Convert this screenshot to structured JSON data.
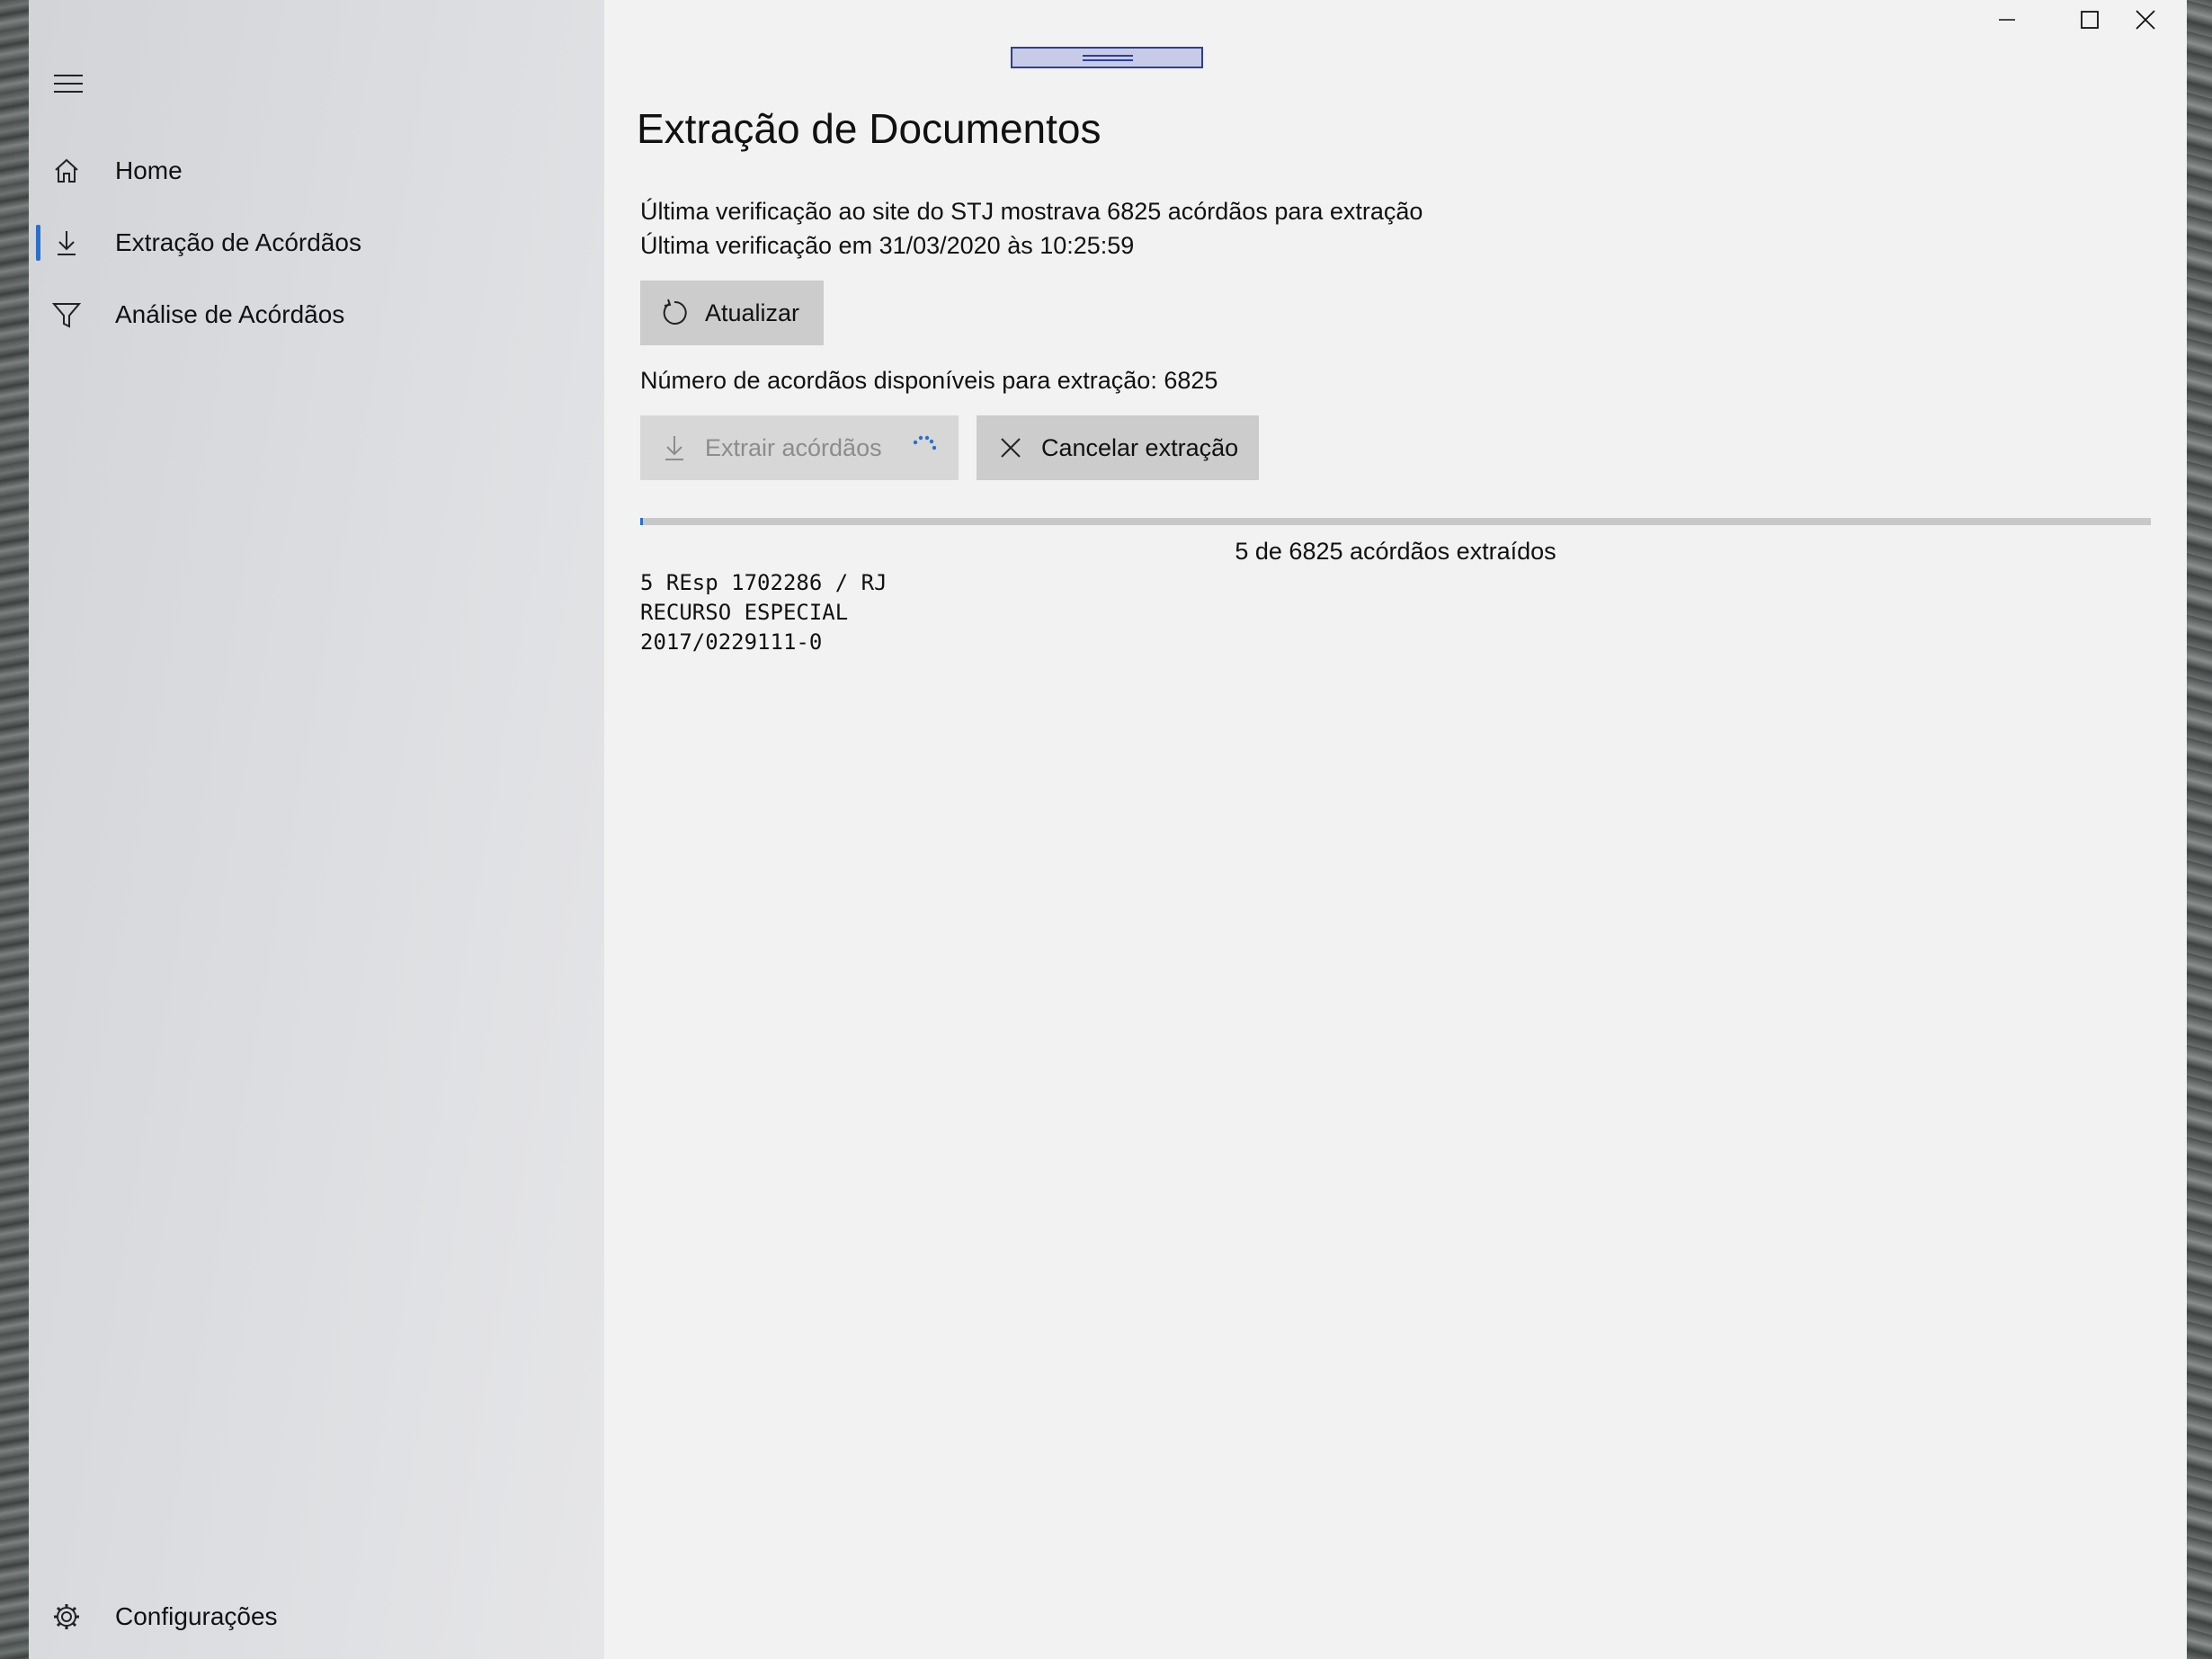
{
  "window": {
    "drag_handle": "drag handle"
  },
  "sidebar": {
    "items": [
      {
        "label": "Home",
        "icon": "home-icon"
      },
      {
        "label": "Extração de Acórdãos",
        "icon": "download-icon",
        "selected": true
      },
      {
        "label": "Análise de Acórdãos",
        "icon": "filter-icon"
      }
    ],
    "settings": {
      "label": "Configurações",
      "icon": "gear-icon"
    }
  },
  "main": {
    "title": "Extração de Documentos",
    "last_check_text": "Última verificação ao site do STJ mostrava 6825 acórdãos para extração",
    "last_check_time": "Última verificação em 31/03/2020 às 10:25:59",
    "refresh_label": "Atualizar",
    "available_text": "Número de acordãos disponíveis para extração: 6825",
    "extract_label": "Extrair acórdãos",
    "cancel_label": "Cancelar extração",
    "progress": {
      "extracted": 5,
      "total": 6825,
      "fraction": 0.00073
    },
    "progress_text": "5 de 6825 acórdãos extraídos",
    "log": {
      "line1": "5 REsp 1702286 / RJ",
      "line2": "RECURSO ESPECIAL",
      "line3": "2017/0229111-0"
    }
  },
  "colors": {
    "accent": "#2a6fc9",
    "button_bg": "#cccccc",
    "content_bg": "#f2f2f2"
  }
}
